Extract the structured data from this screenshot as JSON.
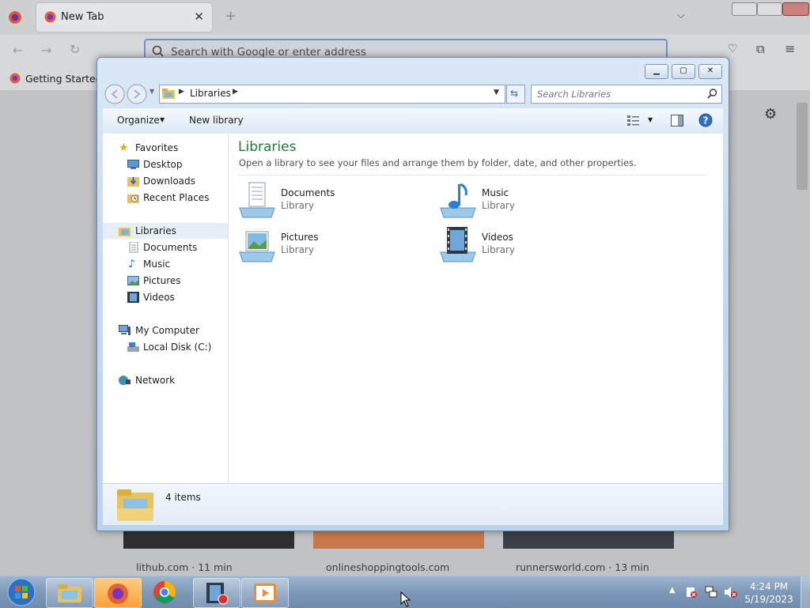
{
  "firefox": {
    "tab_title": "New Tab",
    "url_placeholder": "Search with Google or enter address",
    "bookmark_label": "Getting Started",
    "cards": [
      "lithub.com · 11 min",
      "onlineshoppingtools.com",
      "runnersworld.com · 13 min"
    ]
  },
  "explorer": {
    "breadcrumb": "Libraries",
    "search_placeholder": "Search Libraries",
    "toolbar": {
      "organize": "Organize",
      "new_library": "New library"
    },
    "nav": {
      "favorites": "Favorites",
      "favorites_items": [
        "Desktop",
        "Downloads",
        "Recent Places"
      ],
      "libraries": "Libraries",
      "libraries_items": [
        "Documents",
        "Music",
        "Pictures",
        "Videos"
      ],
      "computer": "My Computer",
      "computer_items": [
        "Local Disk (C:)"
      ],
      "network": "Network"
    },
    "content": {
      "title": "Libraries",
      "subtitle": "Open a library to see your files and arrange them by folder, date, and other properties.",
      "items": [
        {
          "name": "Documents",
          "type": "Library"
        },
        {
          "name": "Music",
          "type": "Library"
        },
        {
          "name": "Pictures",
          "type": "Library"
        },
        {
          "name": "Videos",
          "type": "Library"
        }
      ]
    },
    "status": "4 items"
  },
  "taskbar": {
    "time": "4:24 PM",
    "date": "5/19/2023"
  },
  "colors": {
    "title_green": "#1e7b39",
    "selection": "#e6eef8",
    "taskbar": "#7d98b8"
  }
}
